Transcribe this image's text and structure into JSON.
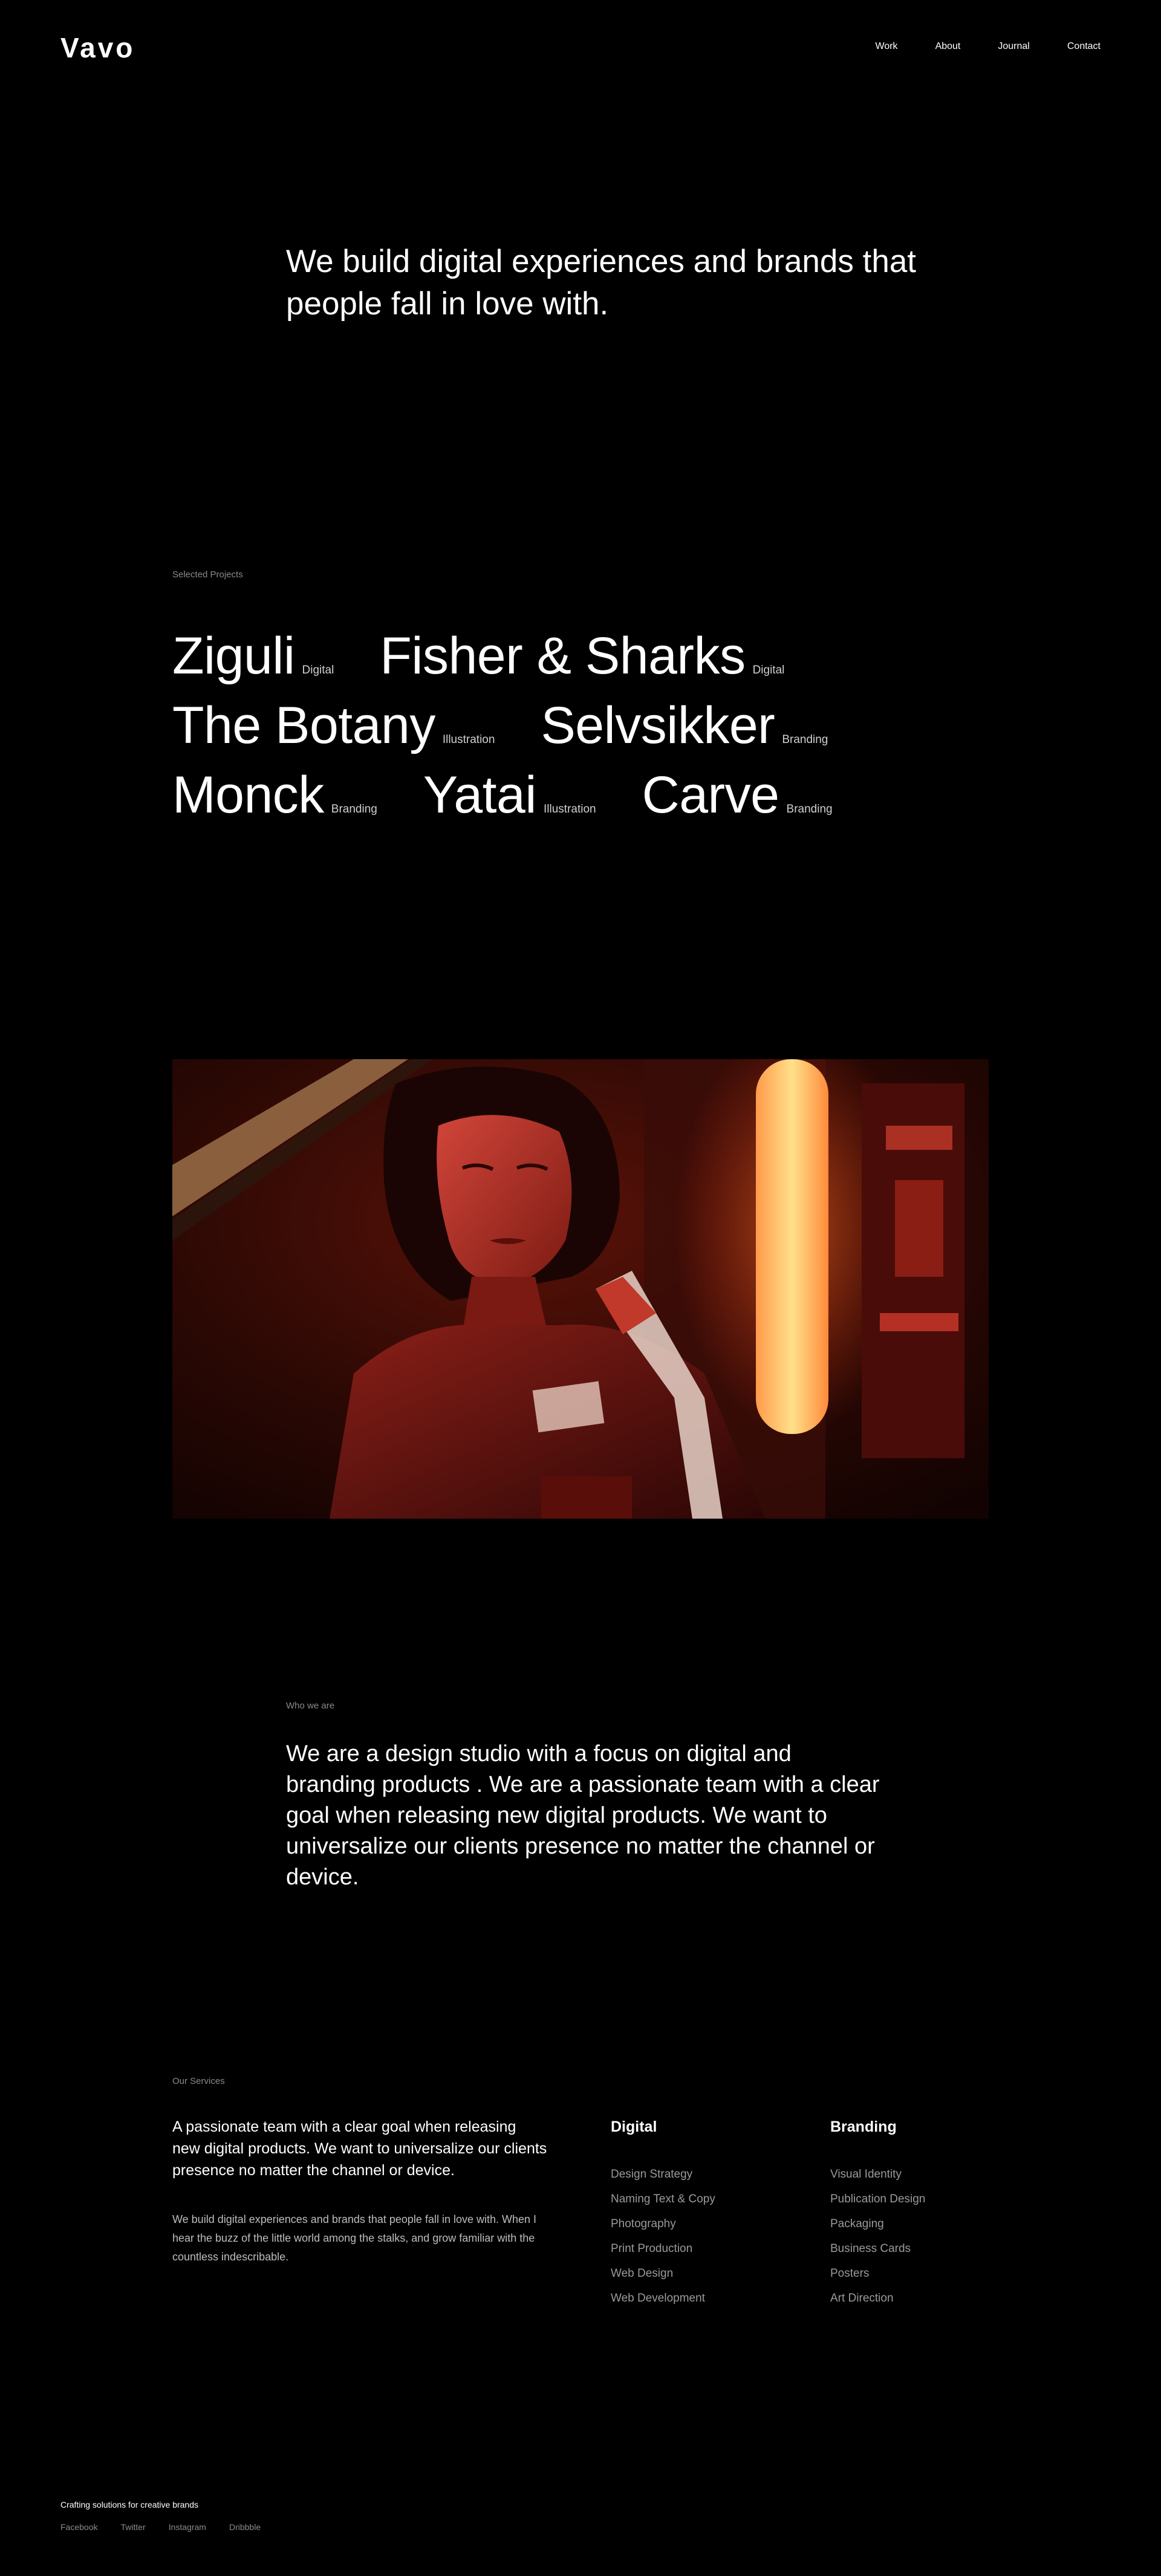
{
  "header": {
    "logo": "Vavo",
    "nav": [
      "Work",
      "About",
      "Journal",
      "Contact"
    ]
  },
  "hero": {
    "headline": "We build digital experiences and brands that people fall in love with."
  },
  "projects": {
    "eyebrow": "Selected Projects",
    "items": [
      {
        "name": "Ziguli",
        "category": "Digital"
      },
      {
        "name": "Fisher & Sharks",
        "category": "Digital"
      },
      {
        "name": "The Botany",
        "category": "Illustration"
      },
      {
        "name": "Selvsikker",
        "category": "Branding"
      },
      {
        "name": "Monck",
        "category": "Branding"
      },
      {
        "name": "Yatai",
        "category": "Illustration"
      },
      {
        "name": "Carve",
        "category": "Branding"
      }
    ]
  },
  "feature_image": {
    "icon": "portrait-photo",
    "accent": "#c0392b"
  },
  "who": {
    "eyebrow": "Who we are",
    "text": "We are a design studio with a focus on digital and branding products . We are a passionate team with a clear goal when releasing new digital products. We want to universalize our clients presence no matter the channel or device."
  },
  "services": {
    "eyebrow": "Our Services",
    "lead": "A passionate team with a clear goal when releasing new digital products. We want to universalize our clients presence no matter the channel or device.",
    "body": "We build digital experiences and brands that people fall in love with. When I hear the buzz of the little world among the stalks, and grow familiar with the countless indescribable.",
    "digital": {
      "title": "Digital",
      "items": [
        "Design Strategy",
        "Naming Text & Copy",
        "Photography",
        "Print Production",
        "Web Design",
        "Web Development"
      ]
    },
    "branding": {
      "title": "Branding",
      "items": [
        "Visual Identity",
        "Publication Design",
        "Packaging",
        "Business Cards",
        "Posters",
        "Art Direction"
      ]
    }
  },
  "footer": {
    "tagline": "Crafting solutions for creative brands",
    "social": [
      "Facebook",
      "Twitter",
      "Instagram",
      "Dribbble"
    ]
  }
}
